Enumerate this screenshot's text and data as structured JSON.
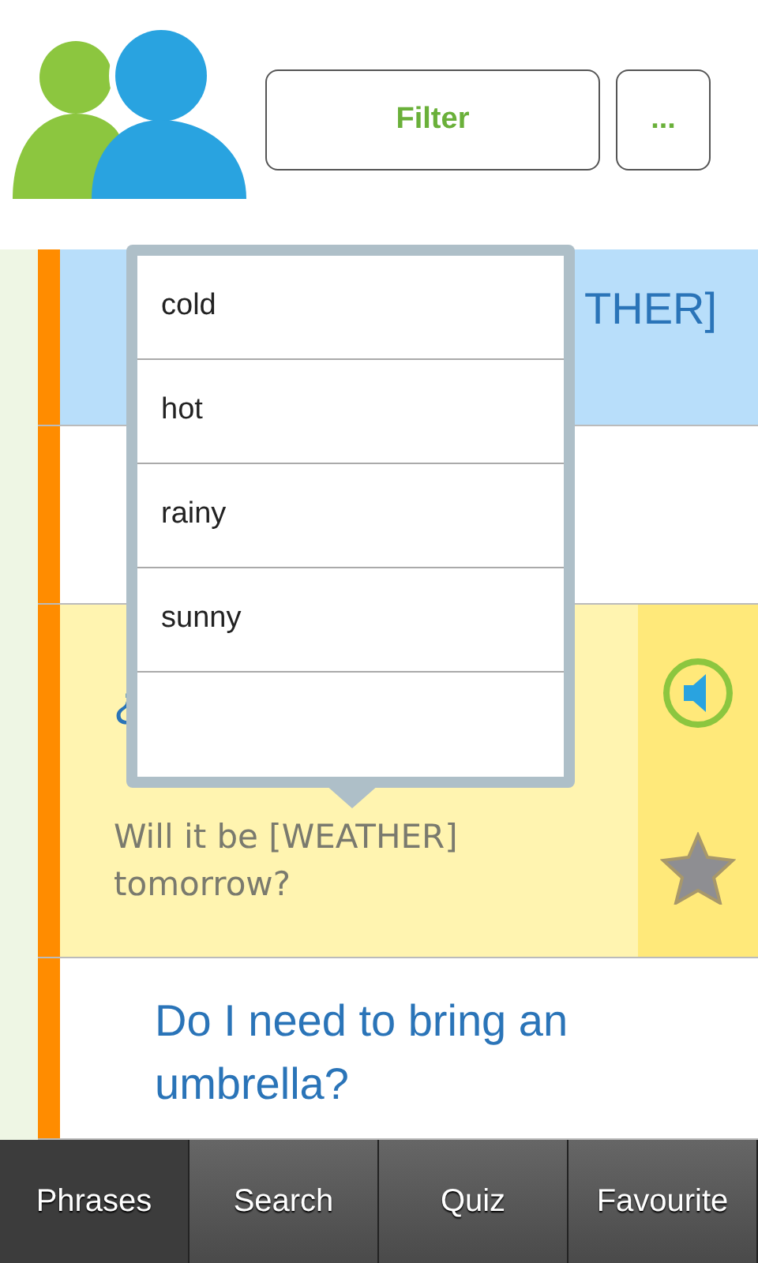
{
  "header": {
    "filter_button": "Filter",
    "more_button": "..."
  },
  "phrases": [
    {
      "kind": "plain",
      "text": "THER]",
      "selected": true
    },
    {
      "kind": "plain",
      "selected": false
    },
    {
      "kind": "expanded",
      "text": "¿",
      "translation": "Will it be [WEATHER] tomorrow?",
      "selected": false
    },
    {
      "kind": "plain",
      "text": "Do I need to bring an umbrella?",
      "selected": false
    }
  ],
  "popup": {
    "options": [
      {
        "kind": "word",
        "label": "cold"
      },
      {
        "kind": "word",
        "label": "hot"
      },
      {
        "kind": "word",
        "label": "rainy"
      },
      {
        "kind": "word",
        "label": "sunny"
      },
      {
        "kind": "blank"
      }
    ]
  },
  "tabs": [
    {
      "label": "Phrases",
      "selected": true
    },
    {
      "label": "Search",
      "selected": false
    },
    {
      "label": "Quiz",
      "selected": false
    },
    {
      "label": "Favourite",
      "selected": false
    }
  ]
}
